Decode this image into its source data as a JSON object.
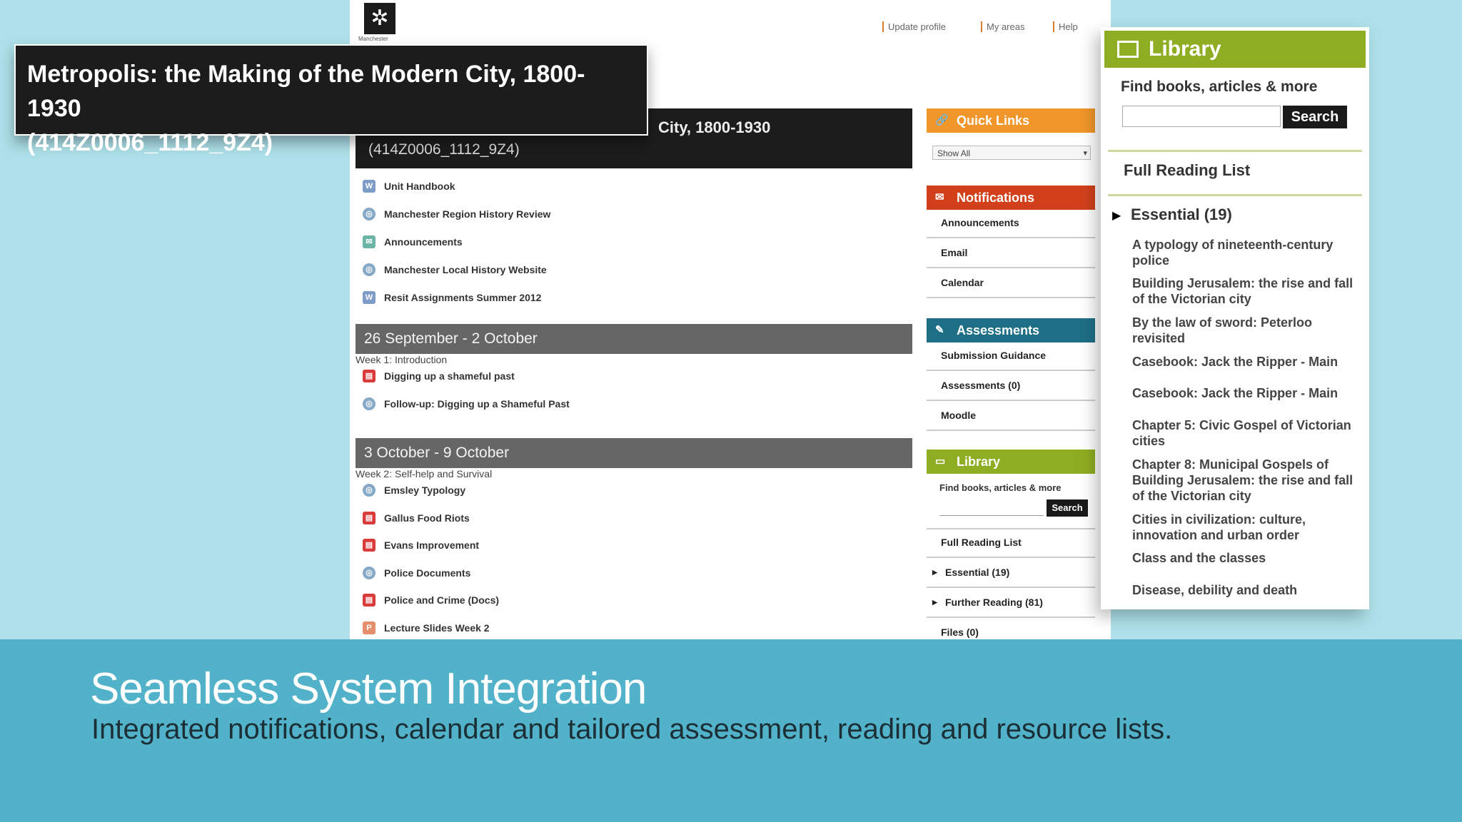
{
  "header": {
    "logo_caption": "Manchester",
    "links": [
      "Update profile",
      "My areas",
      "Help"
    ]
  },
  "unit": {
    "title_partial": "City, 1800-1930",
    "code": "(414Z0006_1112_9Z4)"
  },
  "overlay_title": {
    "line1": "Metropolis: the Making of the Modern City, 1800-1930",
    "line2": "(414Z0006_1112_9Z4)"
  },
  "general_resources": [
    {
      "label": "Unit Handbook",
      "icon": "doc"
    },
    {
      "label": "Manchester Region History Review",
      "icon": "web"
    },
    {
      "label": "Announcements",
      "icon": "ann"
    },
    {
      "label": "Manchester Local History Website",
      "icon": "web"
    },
    {
      "label": "Resit Assignments Summer 2012",
      "icon": "doc"
    }
  ],
  "weeks": [
    {
      "title": "26 September - 2 October",
      "subtitle": "Week 1: Introduction",
      "items": [
        {
          "label": "Digging up a shameful past",
          "icon": "pdf"
        },
        {
          "label": "Follow-up: Digging up a Shameful Past",
          "icon": "web"
        }
      ]
    },
    {
      "title": "3 October - 9 October",
      "subtitle": "Week 2: Self-help and Survival",
      "items": [
        {
          "label": "Emsley Typology",
          "icon": "web"
        },
        {
          "label": "Gallus Food Riots",
          "icon": "pdf"
        },
        {
          "label": "Evans Improvement",
          "icon": "pdf"
        },
        {
          "label": "Police Documents",
          "icon": "web"
        },
        {
          "label": "Police and Crime (Docs)",
          "icon": "pdf"
        },
        {
          "label": "Lecture Slides Week 2",
          "icon": "ppt"
        }
      ]
    }
  ],
  "sidebar": {
    "quick_links": {
      "title": "Quick Links",
      "select_value": "Show All",
      "color": "#f0962a"
    },
    "notifications": {
      "title": "Notifications",
      "items": [
        "Announcements",
        "Email",
        "Calendar"
      ],
      "color": "#d2401b"
    },
    "assessments": {
      "title": "Assessments",
      "items": [
        "Submission Guidance",
        "Assessments (0)",
        "Moodle"
      ],
      "color": "#1e6f85"
    },
    "library": {
      "title": "Library",
      "find_label": "Find books, articles & more",
      "search_button": "Search",
      "full_reading_list": "Full Reading List",
      "essential": "Essential (19)",
      "further": "Further Reading (81)",
      "files": "Files (0)",
      "color": "#8fad22"
    }
  },
  "library_panel": {
    "title": "Library",
    "find_label": "Find books, articles & more",
    "search_button": "Search",
    "full_reading_list": "Full Reading List",
    "essential": "Essential (19)",
    "entries": [
      "A typology of nineteenth-century police",
      "Building Jerusalem: the rise and fall of the Victorian city",
      "By the law of sword: Peterloo revisited",
      "Casebook: Jack the Ripper - Main",
      "Casebook: Jack the Ripper - Main",
      "Chapter 5: Civic Gospel of Victorian cities",
      "Chapter 8: Municipal Gospels of Building Jerusalem: the rise and fall of the Victorian city",
      "Cities in civilization: culture, innovation and urban order",
      "Class and the classes",
      "Disease, debility and death"
    ]
  },
  "banner": {
    "title": "Seamless System Integration",
    "text": "Integrated notifications, calendar and tailored assessment, reading and resource lists."
  }
}
